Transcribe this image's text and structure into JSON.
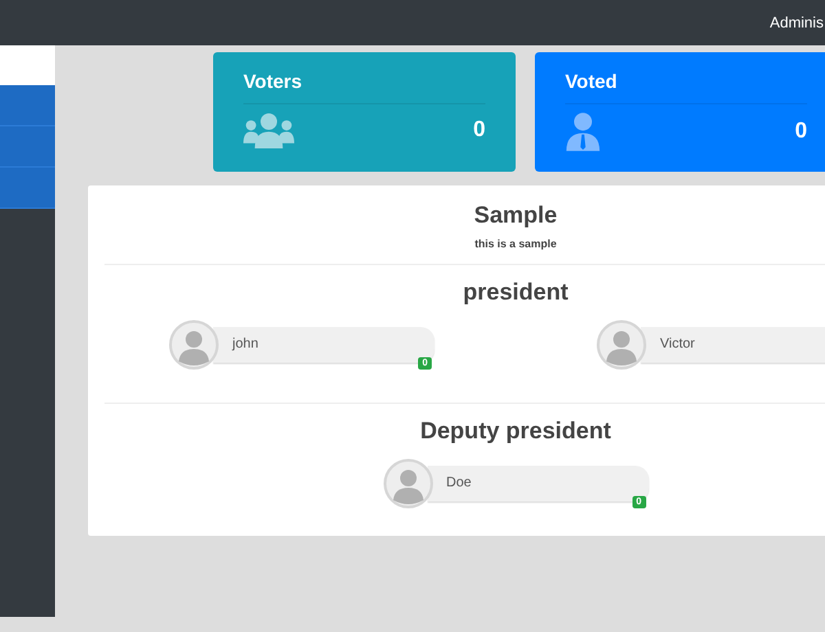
{
  "topbar": {
    "user": "Adminis"
  },
  "stats": [
    {
      "title": "Voters",
      "kind": "group",
      "value": "0",
      "color": "#17a2b8"
    },
    {
      "title": "Voted",
      "kind": "person",
      "value": "0",
      "color": "#007bff"
    }
  ],
  "ballot": {
    "title": "Sample",
    "description": "this is a sample",
    "positions": [
      {
        "name": "president",
        "candidates": [
          {
            "name": "john",
            "votes": "0"
          },
          {
            "name": "Victor"
          }
        ]
      },
      {
        "name": "Deputy president",
        "candidates": [
          {
            "name": "Doe",
            "votes": "0"
          }
        ]
      }
    ]
  }
}
